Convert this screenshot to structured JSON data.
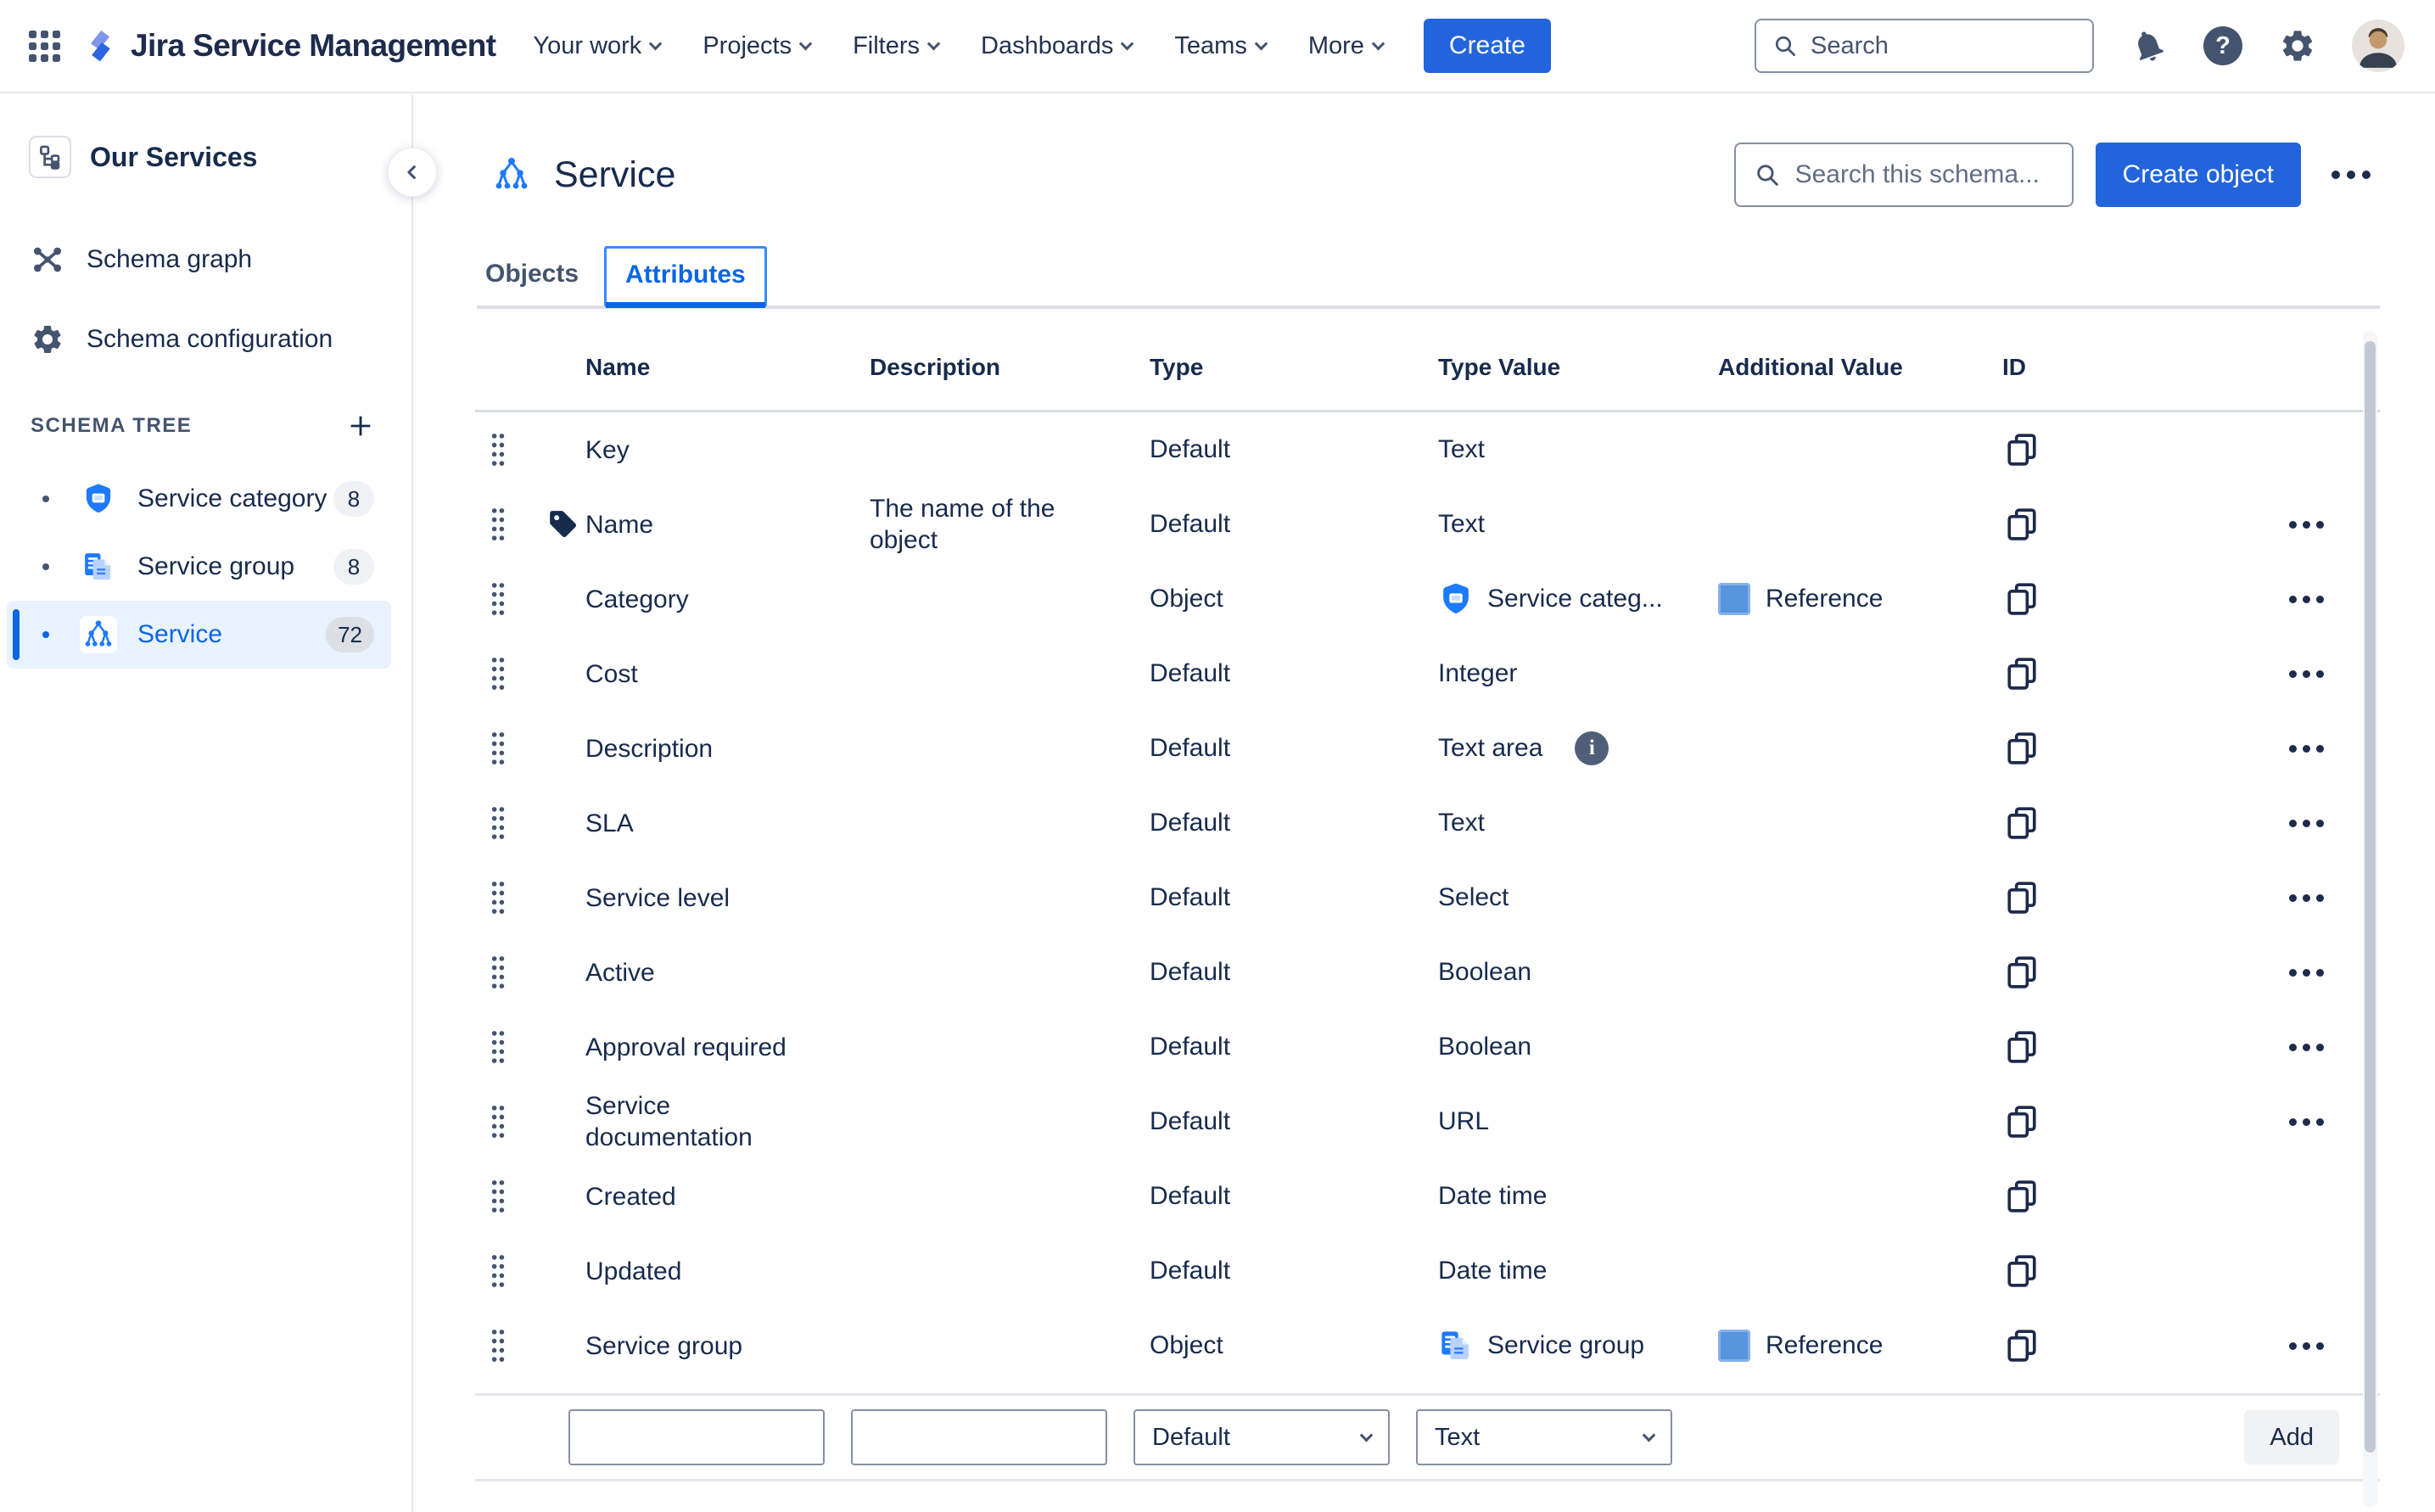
{
  "nav": {
    "wordmark": "Jira Service Management",
    "items": [
      "Your work",
      "Projects",
      "Filters",
      "Dashboards",
      "Teams",
      "More"
    ],
    "create_label": "Create",
    "search_placeholder": "Search"
  },
  "sidebar": {
    "title": "Our Services",
    "nav_items": [
      {
        "label": "Schema graph"
      },
      {
        "label": "Schema configuration"
      }
    ],
    "section_label": "SCHEMA TREE",
    "tree": [
      {
        "label": "Service category",
        "count": "8",
        "icon": "shield",
        "selected": false
      },
      {
        "label": "Service group",
        "count": "8",
        "icon": "pages",
        "selected": false
      },
      {
        "label": "Service",
        "count": "72",
        "icon": "tree",
        "selected": true
      }
    ]
  },
  "main": {
    "title": "Service",
    "schema_search_placeholder": "Search this schema...",
    "create_object_label": "Create object",
    "tabs": [
      {
        "label": "Objects",
        "selected": false
      },
      {
        "label": "Attributes",
        "selected": true
      }
    ],
    "table": {
      "columns": [
        "Name",
        "Description",
        "Type",
        "Type Value",
        "Additional Value",
        "ID"
      ],
      "rows": [
        {
          "name": "Key",
          "description": "",
          "type": "Default",
          "type_value": "Text",
          "has_menu": false
        },
        {
          "name": "Name",
          "name_icon": "tag",
          "description": "The name of the object",
          "type": "Default",
          "type_value": "Text",
          "has_menu": true
        },
        {
          "name": "Category",
          "description": "",
          "type": "Object",
          "type_value": "Service categ...",
          "type_value_icon": "shield",
          "additional_value": "Reference",
          "has_menu": true
        },
        {
          "name": "Cost",
          "description": "",
          "type": "Default",
          "type_value": "Integer",
          "has_menu": true
        },
        {
          "name": "Description",
          "description": "",
          "type": "Default",
          "type_value": "Text area",
          "type_value_info": true,
          "has_menu": true
        },
        {
          "name": "SLA",
          "description": "",
          "type": "Default",
          "type_value": "Text",
          "has_menu": true
        },
        {
          "name": "Service level",
          "description": "",
          "type": "Default",
          "type_value": "Select",
          "has_menu": true
        },
        {
          "name": "Active",
          "description": "",
          "type": "Default",
          "type_value": "Boolean",
          "has_menu": true
        },
        {
          "name": "Approval required",
          "description": "",
          "type": "Default",
          "type_value": "Boolean",
          "has_menu": true
        },
        {
          "name": "Service documentation",
          "description": "",
          "type": "Default",
          "type_value": "URL",
          "has_menu": true
        },
        {
          "name": "Created",
          "description": "",
          "type": "Default",
          "type_value": "Date time",
          "has_menu": false
        },
        {
          "name": "Updated",
          "description": "",
          "type": "Default",
          "type_value": "Date time",
          "has_menu": false
        },
        {
          "name": "Service group",
          "description": "",
          "type": "Object",
          "type_value": "Service group",
          "type_value_icon": "pages",
          "additional_value": "Reference",
          "has_menu": true
        }
      ],
      "add_row": {
        "name_value": "",
        "description_value": "",
        "type_selected": "Default",
        "type_value_selected": "Text",
        "add_label": "Add"
      }
    }
  },
  "colors": {
    "accent_blue": "#2264DC",
    "link_blue": "#0C66E4",
    "focus_blue": "#388BFF",
    "selected_row_bg": "#E9F2FF",
    "text_navy": "#172B4D",
    "icon_slate": "#44546F",
    "divider_gray": "#DCDFE4",
    "object_icon_blue": "#1D7AFC",
    "reference_square_blue": "#5795DC"
  }
}
